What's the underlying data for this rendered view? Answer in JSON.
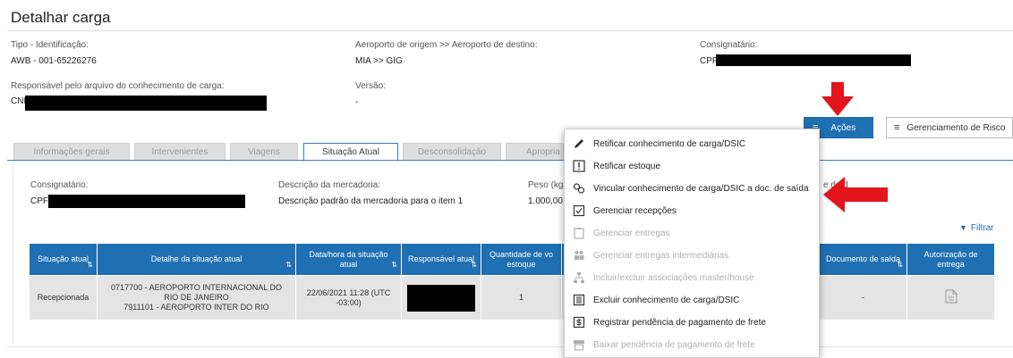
{
  "page": {
    "title": "Detalhar carga"
  },
  "header": {
    "tipo_label": "Tipo - Identificação:",
    "tipo_value": "AWB - 001-65226276",
    "aeroporto_label": "Aeroporto de origem >> Aeroporto de destino:",
    "aeroporto_value": "MIA >> GIG",
    "consignatario_label": "Consignatário:",
    "consignatario_value": "CPF",
    "responsavel_label": "Responsável pelo arquivo do conhecimento de carga:",
    "responsavel_value": "CNPJ",
    "versao_label": "Versão:",
    "versao_value": "-"
  },
  "toolbar": {
    "acoes_label": "Ações",
    "gerenciamento_label": "Gerenciamento de Risco"
  },
  "tabs": [
    {
      "label": "Informações gerais"
    },
    {
      "label": "Intervenientes"
    },
    {
      "label": "Viagens"
    },
    {
      "label": "Situação Atual"
    },
    {
      "label": "Desconsolidação"
    },
    {
      "label": "Apropria"
    }
  ],
  "situacao": {
    "consignatario_label": "Consignatário:",
    "consignatario_value": "CPF",
    "descricao_label": "Descrição da mercadoria:",
    "descricao_value": "Descrição padrão da mercadoria para o item 1",
    "peso_label": "Peso (kg):",
    "peso_value": "1.000,00",
    "extra_label": "e de d"
  },
  "filtrar_label": "Filtrar",
  "table": {
    "headers": [
      "Situação atual",
      "Detalhe da situação atual",
      "Data/hora da situação atual",
      "Responsável atual",
      "Quantidade de vo estoque",
      "",
      "Documento de saída",
      "Autorização de entrega"
    ],
    "row": {
      "situacao": "Recepcionada",
      "detalhe_1": "0717700 - AEROPORTO INTERNACIONAL DO",
      "detalhe_2": "RIO DE JANEIRO",
      "detalhe_3": "7911101 - AEROPORTO INTER DO RIO",
      "datahora_1": "22/06/2021 11:28 (UTC",
      "datahora_2": "-03:00)",
      "quantidade": "1",
      "documento": "-"
    }
  },
  "menu": {
    "items": [
      {
        "label": "Retificar conhecimento de carga/DSIC",
        "icon": "pencil-icon",
        "enabled": true
      },
      {
        "label": "Retificar estoque",
        "icon": "exclamation-box-icon",
        "enabled": true
      },
      {
        "label": "Vincular conhecimento de carga/DSIC a doc. de saída",
        "icon": "link-icon",
        "enabled": true
      },
      {
        "label": "Gerenciar recepções",
        "icon": "clipboard-check-icon",
        "enabled": true
      },
      {
        "label": "Gerenciar entregas",
        "icon": "clipboard-icon",
        "enabled": false
      },
      {
        "label": "Gerenciar entregas intermediárias",
        "icon": "people-icon",
        "enabled": false
      },
      {
        "label": "Incluir/excluir associações master/house",
        "icon": "hierarchy-icon",
        "enabled": false
      },
      {
        "label": "Excluir conhecimento de carga/DSIC",
        "icon": "trash-icon",
        "enabled": true
      },
      {
        "label": "Registrar pendência de pagamento de frete",
        "icon": "money-doc-icon",
        "enabled": true
      },
      {
        "label": "Baixar pendência de pagamento de frete",
        "icon": "money-box-icon",
        "enabled": false
      }
    ]
  },
  "colors": {
    "accent": "#1f6fb3",
    "arrow": "#e3141b",
    "table_row": "#e4e4e4"
  }
}
